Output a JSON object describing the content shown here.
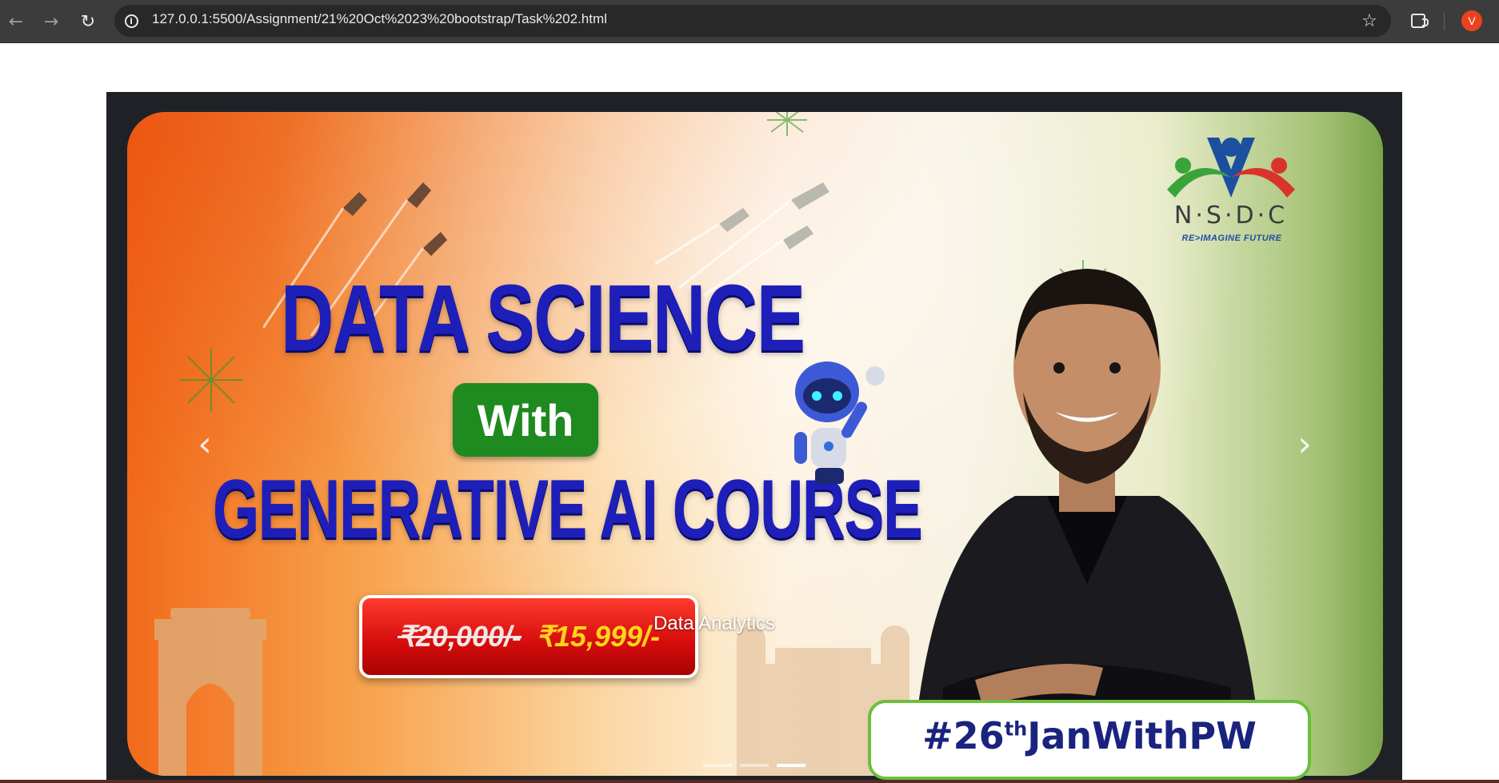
{
  "browser": {
    "url": "127.0.0.1:5500/Assignment/21%20Oct%2023%20bootstrap/Task%202.html",
    "profile_initial": "V",
    "icons": {
      "back": "arrow-left-icon",
      "forward": "arrow-right-icon",
      "reload": "reload-icon",
      "site_info": "info-icon",
      "bookmark": "star-icon",
      "extensions": "puzzle-icon"
    },
    "colors": {
      "chrome_bg": "#3c3c3c",
      "omnibox_bg": "#282828",
      "avatar_bg": "#e8431f"
    }
  },
  "carousel": {
    "slide": {
      "heading_line1": "DATA SCIENCE",
      "badge": "With",
      "heading_line2": "GENERATIVE AI COURSE",
      "price_old": "₹20,000/-",
      "price_new": "₹15,999/-",
      "logo_text": "N·S·D·C",
      "logo_tagline": "RE>IMAGINE FUTURE",
      "hashtag_prefix": "#26",
      "hashtag_sup": "th",
      "hashtag_suffix": "JanWithPW",
      "caption": "Data Analytics"
    },
    "controls": {
      "prev_icon": "chevron-left-icon",
      "next_icon": "chevron-right-icon"
    },
    "indicators": {
      "count": 3,
      "active_index": 2
    },
    "colors": {
      "frame_bg": "#1e2226",
      "heading": "#1e1fb8",
      "badge_bg": "#1f8a1f",
      "price_bg": "#d40b0b",
      "price_new": "#ffd21f",
      "hashtag": "#1a237e"
    }
  }
}
